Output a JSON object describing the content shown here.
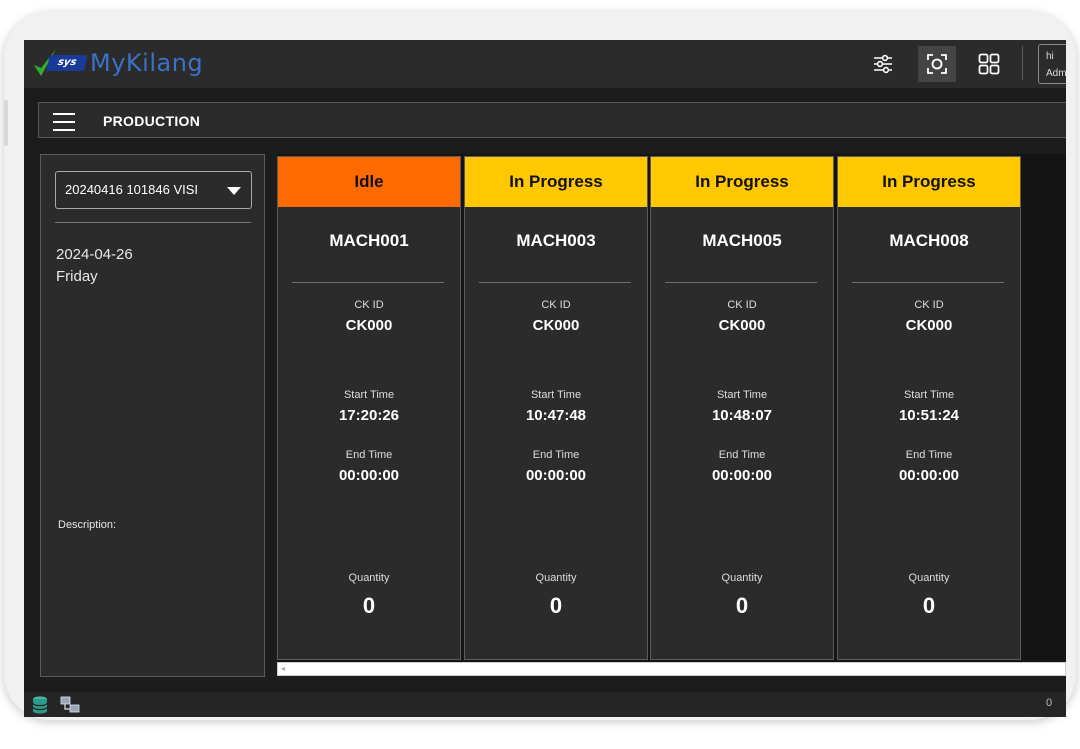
{
  "app": {
    "logo_badge": "sys",
    "logo_text": "MyKilang"
  },
  "topbar": {
    "icons": [
      "sliders-icon",
      "focus-icon",
      "grid-icon"
    ],
    "user_line1": "hi",
    "user_line2": "Adm"
  },
  "page": {
    "title": "PRODUCTION"
  },
  "left_panel": {
    "selected_batch": "20240416 101846 VISI",
    "date": "2024-04-26",
    "day": "Friday",
    "description_label": "Description:"
  },
  "labels": {
    "ck_id": "CK ID",
    "start_time": "Start Time",
    "end_time": "End Time",
    "quantity": "Quantity"
  },
  "machines": [
    {
      "status": "Idle",
      "status_color": "#ff6a00",
      "name": "MACH001",
      "ck_id": "CK000",
      "start_time": "17:20:26",
      "end_time": "00:00:00",
      "quantity": "0"
    },
    {
      "status": "In Progress",
      "status_color": "#ffc800",
      "name": "MACH003",
      "ck_id": "CK000",
      "start_time": "10:47:48",
      "end_time": "00:00:00",
      "quantity": "0"
    },
    {
      "status": "In Progress",
      "status_color": "#ffc800",
      "name": "MACH005",
      "ck_id": "CK000",
      "start_time": "10:48:07",
      "end_time": "00:00:00",
      "quantity": "0"
    },
    {
      "status": "In Progress",
      "status_color": "#ffc800",
      "name": "MACH008",
      "ck_id": "CK000",
      "start_time": "10:51:24",
      "end_time": "00:00:00",
      "quantity": "0"
    }
  ],
  "status_bar": {
    "right_text": "0"
  },
  "colors": {
    "background": "#1c1c1c",
    "panel": "#2b2b2b",
    "idle": "#ff6a00",
    "in_progress": "#ffc800"
  }
}
